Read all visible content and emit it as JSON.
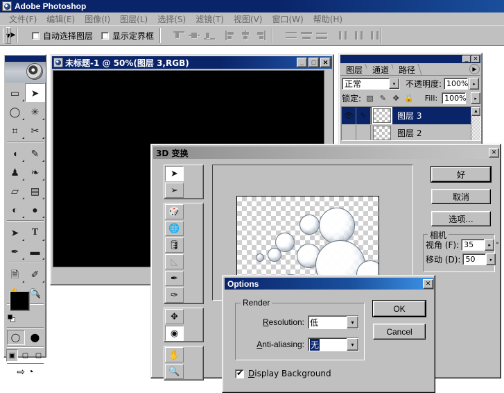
{
  "app": {
    "title": "Adobe Photoshop",
    "icon": "photoshop-icon",
    "menus": [
      {
        "label": "文件(F)"
      },
      {
        "label": "编辑(E)"
      },
      {
        "label": "图像(I)"
      },
      {
        "label": "图层(L)"
      },
      {
        "label": "选择(S)"
      },
      {
        "label": "滤镜(T)"
      },
      {
        "label": "视图(V)"
      },
      {
        "label": "窗口(W)"
      },
      {
        "label": "帮助(H)"
      }
    ]
  },
  "options_bar": {
    "tool_icon": "move-tool-icon",
    "auto_select_layer": {
      "label": "自动选择图层",
      "checked": false
    },
    "show_bounding_box": {
      "label": "显示定界框",
      "checked": false
    },
    "align_icons": [
      "align-top-edges-icon",
      "align-vertical-centers-icon",
      "align-bottom-edges-icon",
      "align-left-edges-icon",
      "align-horizontal-centers-icon",
      "align-right-edges-icon",
      "distribute-top-edges-icon",
      "distribute-vertical-centers-icon",
      "distribute-bottom-edges-icon",
      "distribute-left-edges-icon",
      "distribute-horizontal-centers-icon",
      "distribute-right-edges-icon"
    ]
  },
  "toolbox": {
    "tools": [
      {
        "name": "marquee-tool",
        "glyph": "▭"
      },
      {
        "name": "move-tool",
        "glyph": "➤",
        "active": true
      },
      {
        "name": "lasso-tool",
        "glyph": "◯"
      },
      {
        "name": "magic-wand-tool",
        "glyph": "✳"
      },
      {
        "name": "crop-tool",
        "glyph": "⌗"
      },
      {
        "name": "slice-tool",
        "glyph": "✂"
      },
      {
        "name": "healing-brush-tool",
        "glyph": "◖"
      },
      {
        "name": "brush-tool",
        "glyph": "✎"
      },
      {
        "name": "stamp-tool",
        "glyph": "♟"
      },
      {
        "name": "history-brush-tool",
        "glyph": "❧"
      },
      {
        "name": "eraser-tool",
        "glyph": "▱"
      },
      {
        "name": "gradient-tool",
        "glyph": "▤"
      },
      {
        "name": "blur-tool",
        "glyph": "💧"
      },
      {
        "name": "dodge-tool",
        "glyph": "●"
      },
      {
        "name": "path-selection-tool",
        "glyph": "➤"
      },
      {
        "name": "type-tool",
        "glyph": "T"
      },
      {
        "name": "pen-tool",
        "glyph": "✒"
      },
      {
        "name": "shape-tool",
        "glyph": "▬"
      },
      {
        "name": "notes-tool",
        "glyph": "🗎"
      },
      {
        "name": "eyedropper-tool",
        "glyph": "✐"
      },
      {
        "name": "hand-tool",
        "glyph": "✋"
      },
      {
        "name": "zoom-tool",
        "glyph": "🔍"
      }
    ],
    "foreground_color": "#000000",
    "background_color": "#ffffff",
    "swap_icon": "swap-colors-icon",
    "default_colors_icon": "default-colors-icon",
    "screen_modes": [
      "standard-screen-mode",
      "full-screen-with-menubar",
      "full-screen-mode"
    ],
    "quickmask_modes": [
      "standard-mode-icon",
      "quickmask-mode-icon"
    ],
    "jump_to_icon": "jump-to-imageready-icon"
  },
  "document_window": {
    "title": "未标题-1 @ 50%(图层 3,RGB)",
    "icon": "document-icon",
    "minimize_label": "_",
    "maximize_label": "□",
    "close_label": "✕",
    "canvas_color": "#000000"
  },
  "layers_palette": {
    "collapse_label": "_",
    "close_label": "✕",
    "tabs": [
      {
        "label": "图层",
        "active": true
      },
      {
        "label": "通道",
        "active": false
      },
      {
        "label": "路径",
        "active": false
      }
    ],
    "menu_icon": "palette-menu-icon",
    "blend_mode": "正常",
    "opacity_label": "不透明度:",
    "opacity_value": "100%",
    "lock_label": "锁定:",
    "lock_icons": [
      "lock-transparent-pixels-icon",
      "lock-image-pixels-icon",
      "lock-position-icon",
      "lock-all-icon"
    ],
    "fill_label": "Fill:",
    "fill_value": "100%",
    "layers": [
      {
        "name": "图层 3",
        "visible": true,
        "selected": true,
        "thumb": "transparent-thumb"
      },
      {
        "name": "图层 2",
        "visible": false,
        "selected": false,
        "thumb": "bubbles-thumb"
      }
    ]
  },
  "dialog_3d": {
    "title": "3D 变换",
    "close_label": "✕",
    "tools": [
      {
        "name": "selection-tool-icon",
        "glyph": "➤",
        "selected": true
      },
      {
        "name": "direct-selection-tool-icon",
        "glyph": "➢",
        "selected": false
      },
      {
        "name": "cube-tool-icon",
        "glyph": "🎲",
        "selected": false
      },
      {
        "name": "sphere-tool-icon",
        "glyph": "🌐",
        "selected": false
      },
      {
        "name": "cylinder-tool-icon",
        "glyph": "🛢",
        "selected": false
      },
      {
        "name": "convert-anchor-point-tool-icon",
        "glyph": "◺",
        "selected": false,
        "disabled": true
      },
      {
        "name": "add-anchor-point-tool-icon",
        "glyph": "✒",
        "selected": false
      },
      {
        "name": "delete-anchor-point-tool-icon",
        "glyph": "✑",
        "selected": false
      },
      {
        "name": "pan-camera-tool-icon",
        "glyph": "✥",
        "selected": false
      },
      {
        "name": "trackball-tool-icon",
        "glyph": "◉",
        "selected": true
      },
      {
        "name": "hand-tool-icon",
        "glyph": "✋",
        "selected": false
      },
      {
        "name": "zoom-tool-icon",
        "glyph": "🔍",
        "selected": false
      }
    ],
    "buttons": [
      {
        "label": "好",
        "name": "ok-button",
        "default": true
      },
      {
        "label": "取消",
        "name": "cancel-button",
        "default": false
      },
      {
        "label": "选项...",
        "name": "options-button",
        "default": false
      }
    ],
    "camera_group": {
      "title": "相机",
      "fields": [
        {
          "label": "视角 (F):",
          "value": "35",
          "unit": "°"
        },
        {
          "label": "移动 (D):",
          "value": "50",
          "unit": ""
        }
      ]
    },
    "preview": {
      "name": "bubbles-preview",
      "checker": true
    }
  },
  "dialog_options": {
    "title": "Options",
    "close_label": "✕",
    "render_group": {
      "title": "Render",
      "fields": [
        {
          "label_prefix": "R",
          "label_rest": "esolution:",
          "value": "低",
          "selected": false,
          "name": "resolution-select"
        },
        {
          "label_prefix": "A",
          "label_rest": "nti-aliasing:",
          "value": "无",
          "selected": true,
          "name": "antialiasing-select"
        }
      ]
    },
    "buttons": [
      {
        "label": "OK",
        "name": "ok-button",
        "default": true
      },
      {
        "label": "Cancel",
        "name": "cancel-button",
        "default": false
      }
    ],
    "display_background": {
      "label_prefix": "D",
      "label_rest": "isplay Background",
      "checked": true
    }
  },
  "colors": {
    "titlebar_active": "#0a246a",
    "titlebar_inactive": "#8e8e8e",
    "face": "#c0c0c0",
    "selection": "#0a246a"
  }
}
